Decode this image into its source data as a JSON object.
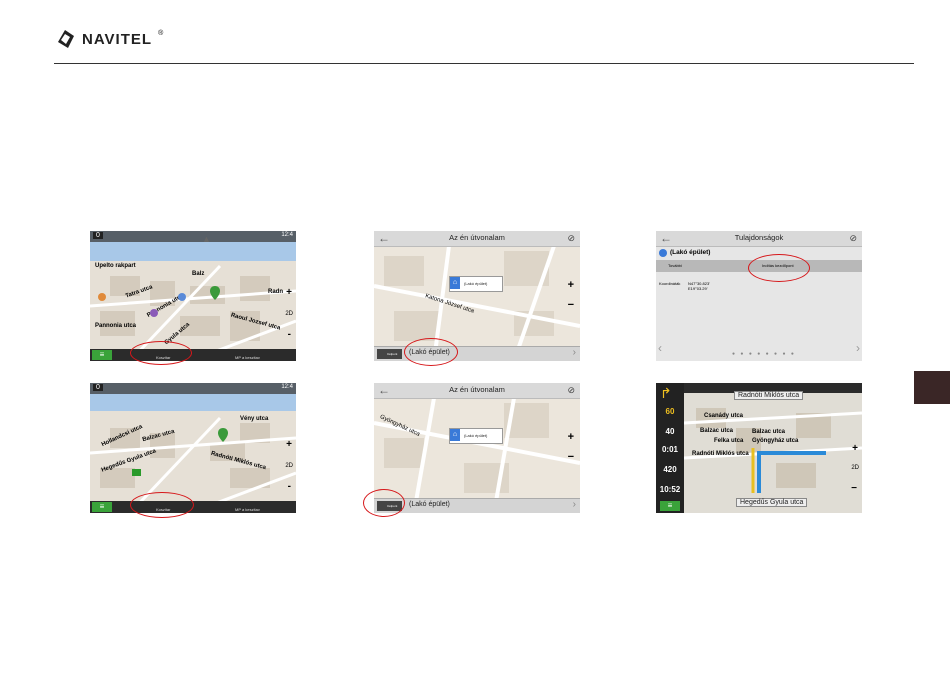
{
  "brand": {
    "name": "NAVITEL",
    "registered": "®"
  },
  "screens": {
    "s1": {
      "badge": "0",
      "streets": [
        "Upelto rakpart",
        "Tatra utca",
        "Pannonia utca",
        "Pannonia utca",
        "Balz",
        "Radn",
        "Raoul Jozsef utca",
        "Gyula utca"
      ],
      "bottom": [
        "Koszitar",
        "MP a keszitav"
      ],
      "zoom": [
        "2D",
        "+",
        "-"
      ]
    },
    "s2": {
      "title": "Az én útvonalam",
      "popup": "(Lakó épület)",
      "street": "Katona József utca",
      "route_text": "(Lakó épület)",
      "flag": "Célpont"
    },
    "s3": {
      "title": "Tulajdonságok",
      "place": "(Lakó épület)",
      "action_left": "További",
      "action_right": "Indítás kezdőpont",
      "coord_label": "Koordináták",
      "coord_value": "N47°30.823'\nE19°03.29'"
    },
    "s4": {
      "badge": "0",
      "streets": [
        "Hollandcsi utca",
        "Balzac utca",
        "Hegedűs Gyula utca",
        "Radnóti Miklós utca",
        "Vény utca"
      ],
      "bottom": [
        "Koszitar",
        "MP a keszitav"
      ],
      "zoom": [
        "2D",
        "+",
        "-"
      ]
    },
    "s5": {
      "title": "Az én útvonalam",
      "popup": "(Lakó épület)",
      "street": "Gyöngyház utca",
      "route_text": "(Lakó épület)",
      "flag": "Célpont"
    },
    "s6": {
      "top_street": "Radnóti Miklós utca",
      "bottom_street": "Hegedűs Gyula utca",
      "speed": "60",
      "dist": "40",
      "time_left": "0:01",
      "dist_left": "420",
      "clock": "10:52",
      "streets": [
        "Csanády utca",
        "Balzac utca",
        "Felka utca",
        "Radnóti Miklós utca",
        "Balzac utca",
        "Gyöngyház utca"
      ]
    }
  }
}
